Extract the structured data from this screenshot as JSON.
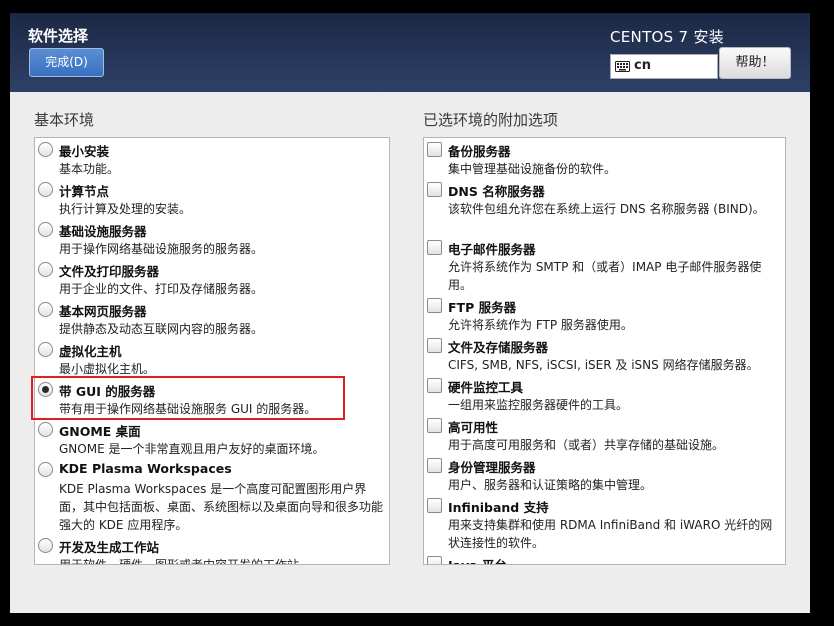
{
  "header": {
    "page_title": "软件选择",
    "done_label": "完成(D)",
    "product": "CENTOS 7 安装",
    "keyboard_layout": "cn",
    "help_label": "帮助！"
  },
  "left": {
    "title": "基本环境",
    "items": [
      {
        "name": "最小安装",
        "desc": "基本功能。",
        "selected": false
      },
      {
        "name": "计算节点",
        "desc": "执行计算及处理的安装。",
        "selected": false
      },
      {
        "name": "基础设施服务器",
        "desc": "用于操作网络基础设施服务的服务器。",
        "selected": false
      },
      {
        "name": "文件及打印服务器",
        "desc": "用于企业的文件、打印及存储服务器。",
        "selected": false
      },
      {
        "name": "基本网页服务器",
        "desc": "提供静态及动态互联网内容的服务器。",
        "selected": false
      },
      {
        "name": "虚拟化主机",
        "desc": "最小虚拟化主机。",
        "selected": false
      },
      {
        "name": "带 GUI 的服务器",
        "desc": "带有用于操作网络基础设施服务 GUI 的服务器。",
        "selected": true
      },
      {
        "name": "GNOME 桌面",
        "desc": "GNOME 是一个非常直观且用户友好的桌面环境。",
        "selected": false
      },
      {
        "name": "KDE Plasma Workspaces",
        "desc": "KDE Plasma Workspaces 是一个高度可配置图形用户界面，其中包括面板、桌面、系统图标以及桌面向导和很多功能强大的 KDE 应用程序。",
        "selected": false
      },
      {
        "name": "开发及生成工作站",
        "desc": "用于软件、硬件、图形或者内容开发的工作站。",
        "selected": false
      }
    ]
  },
  "right": {
    "title": "已选环境的附加选项",
    "items": [
      {
        "name": "备份服务器",
        "desc": "集中管理基础设施备份的软件。"
      },
      {
        "name": "DNS 名称服务器",
        "desc": "该软件包组允许您在系统上运行 DNS 名称服务器 (BIND)。"
      },
      {
        "name": "电子邮件服务器",
        "desc": "允许将系统作为 SMTP 和（或者）IMAP 电子邮件服务器使用。"
      },
      {
        "name": "FTP 服务器",
        "desc": "允许将系统作为 FTP 服务器使用。"
      },
      {
        "name": "文件及存储服务器",
        "desc": "CIFS, SMB, NFS, iSCSI, iSER 及 iSNS 网络存储服务器。"
      },
      {
        "name": "硬件监控工具",
        "desc": "一组用来监控服务器硬件的工具。"
      },
      {
        "name": "高可用性",
        "desc": "用于高度可用服务和（或者）共享存储的基础设施。"
      },
      {
        "name": "身份管理服务器",
        "desc": "用户、服务器和认证策略的集中管理。"
      },
      {
        "name": "Infiniband 支持",
        "desc": "用来支持集群和使用 RDMA InfiniBand 和 iWARO 光纤的网状连接性的软件。"
      },
      {
        "name": "Java 平台",
        "desc": ""
      }
    ]
  }
}
